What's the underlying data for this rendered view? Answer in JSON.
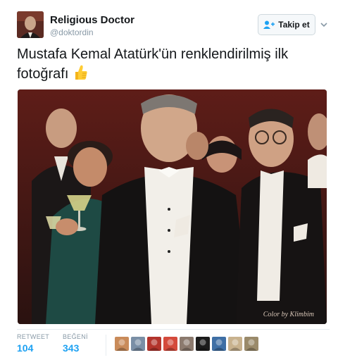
{
  "header": {
    "display_name": "Religious Doctor",
    "handle": "@doktordin",
    "follow_label": "Takip et"
  },
  "tweet": {
    "text": "Mustafa Kemal Atatürk'ün renklendirilmiş ilk fotoğrafı",
    "emoji": "thumbs-up-icon"
  },
  "photo": {
    "credit": "Color by Klimbim"
  },
  "stats": {
    "retweet_label": "RETWEET",
    "retweet_count": "104",
    "like_label": "BEĞENİ",
    "like_count": "343"
  },
  "likers": [
    {
      "color": "#c98b5a"
    },
    {
      "color": "#7a8fa6"
    },
    {
      "color": "#b3342c"
    },
    {
      "color": "#d44a3c"
    },
    {
      "color": "#8c7a6e"
    },
    {
      "color": "#1b1b1b"
    },
    {
      "color": "#3f6fa5"
    },
    {
      "color": "#c8b28e"
    },
    {
      "color": "#9a8a6a"
    }
  ],
  "colors": {
    "accent": "#1da1f2",
    "muted": "#8899a6"
  }
}
